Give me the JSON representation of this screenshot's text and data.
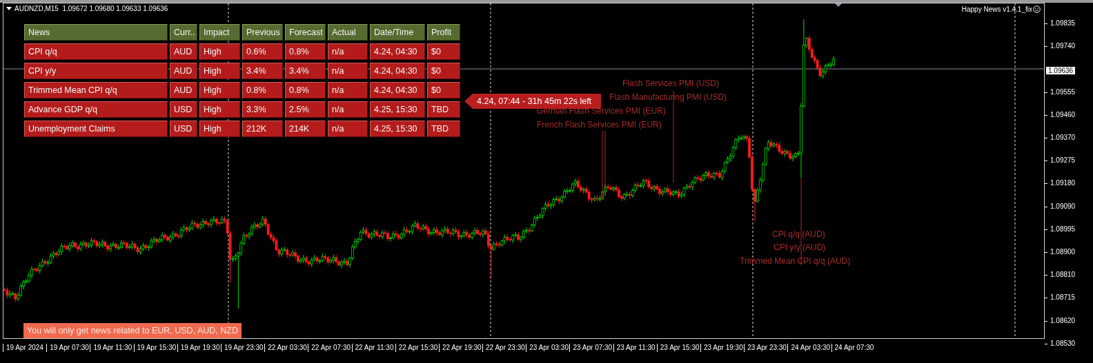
{
  "chart": {
    "symbol_line": "AUDNZD,M15  1.09672 1.09680 1.09633 1.09636",
    "indicator_label": "Happy News v1.4.1_fix",
    "current_price": "1.09636",
    "price_axis": [
      "1.09835",
      "1.09740",
      "1.09555",
      "1.09460",
      "1.09370",
      "1.09275",
      "1.09180",
      "1.09090",
      "1.08995",
      "1.08900",
      "1.08810",
      "1.08715",
      "1.08620",
      "1.08530"
    ],
    "time_axis": [
      "19 Apr 2024",
      "19 Apr 07:30",
      "19 Apr 11:30",
      "19 Apr 15:30",
      "19 Apr 19:30",
      "19 Apr 23:30",
      "22 Apr 03:30",
      "22 Apr 07:30",
      "22 Apr 11:30",
      "22 Apr 15:30",
      "22 Apr 19:30",
      "22 Apr 23:30",
      "23 Apr 03:30",
      "23 Apr 07:30",
      "23 Apr 11:30",
      "23 Apr 15:30",
      "23 Apr 19:30",
      "23 Apr 23:30",
      "24 Apr 03:30",
      "24 Apr 07:30"
    ],
    "events": [
      {
        "label": "Flash Services PMI (USD)"
      },
      {
        "label": "Flash Manufacturing PMI (USD)"
      },
      {
        "label": "German Flash Services PMI (EUR)"
      },
      {
        "label": "French Flash Services PMI (EUR)"
      },
      {
        "label": "CPI q/q (AUD)"
      },
      {
        "label": "CPI y/y (AUD)"
      },
      {
        "label": "Trimmed Mean CPI q/q (AUD)"
      }
    ]
  },
  "news_table": {
    "columns": [
      "News",
      "Curr..",
      "Impact",
      "Previous",
      "Forecast",
      "Actual",
      "Date/Time",
      "Profit"
    ],
    "rows": [
      {
        "cells": [
          "CPI q/q",
          "AUD",
          "High",
          "0.6%",
          "0.8%",
          "n/a",
          "4.24, 04:30",
          "$0"
        ]
      },
      {
        "cells": [
          "CPI y/y",
          "AUD",
          "High",
          "3.4%",
          "3.4%",
          "n/a",
          "4.24, 04:30",
          "$0"
        ]
      },
      {
        "cells": [
          "Trimmed Mean CPI q/q",
          "AUD",
          "High",
          "0.8%",
          "0.8%",
          "n/a",
          "4.24, 04:30",
          "$0"
        ]
      },
      {
        "cells": [
          "Advance GDP q/q",
          "USD",
          "High",
          "3.3%",
          "2.5%",
          "n/a",
          "4.25, 15:30",
          "TBD"
        ]
      },
      {
        "cells": [
          "Unemployment Claims",
          "USD",
          "High",
          "212K",
          "214K",
          "n/a",
          "4.25, 15:30",
          "TBD"
        ]
      }
    ]
  },
  "countdown": "4.24, 07:44 - 31h 45m 22s left",
  "notice": "You will only get news related to EUR, USD, AUD, NZD"
}
